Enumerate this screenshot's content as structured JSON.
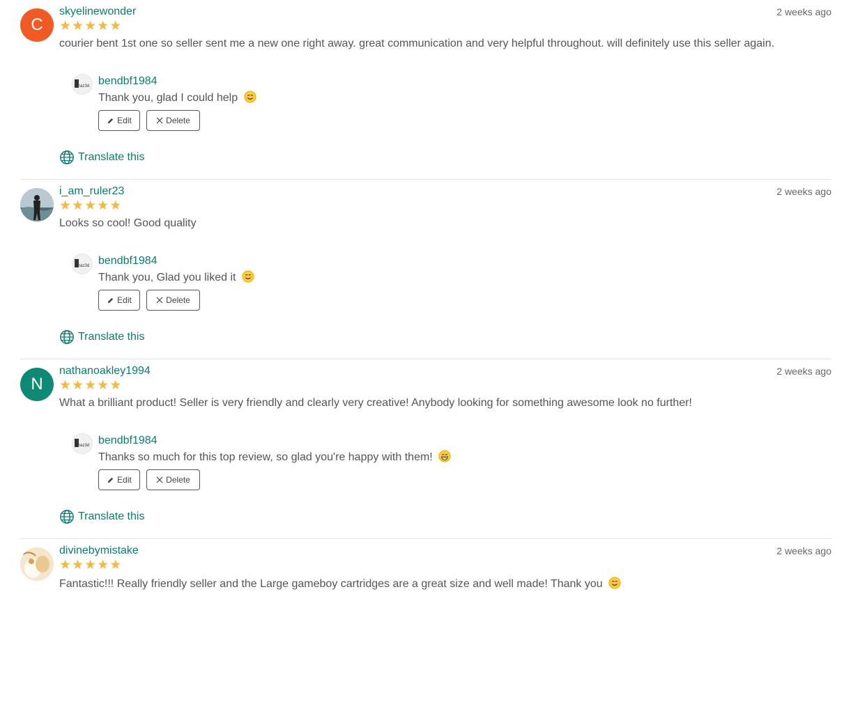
{
  "reviews": [
    {
      "username": "skyelinewonder",
      "avatar_letter": "C",
      "avatar_color": "#f05a24",
      "date": "2 weeks ago",
      "stars": 5,
      "text": "courier bent 1st one so seller sent me a new one right away. great communication and very helpful throughout. will definitely use this seller again.",
      "reply": {
        "username": "bendbf1984",
        "avatar_text": "Phaz3d",
        "text": "Thank you, glad I could help",
        "emoji": "smiling-face-icon"
      },
      "edit_label": "Edit",
      "delete_label": "Delete",
      "translate_label": "Translate this"
    },
    {
      "username": "i_am_ruler23",
      "avatar_letter": "",
      "avatar_color": "#8aa4b0",
      "date": "2 weeks ago",
      "stars": 5,
      "text": "Looks so cool! Good quality",
      "reply": {
        "username": "bendbf1984",
        "avatar_text": "Phaz3d",
        "text": "Thank you, Glad you liked it",
        "emoji": "smiling-face-icon"
      },
      "edit_label": "Edit",
      "delete_label": "Delete",
      "translate_label": "Translate this"
    },
    {
      "username": "nathanoakley1994",
      "avatar_letter": "N",
      "avatar_color": "#0e8a74",
      "date": "2 weeks ago",
      "stars": 5,
      "text": "What a brilliant product! Seller is very friendly and clearly very creative! Anybody looking for something awesome look no further!",
      "reply": {
        "username": "bendbf1984",
        "avatar_text": "Phaz3d",
        "text": "Thanks so much for this top review, so glad you're happy with them!",
        "emoji": "grinning-face-icon"
      },
      "edit_label": "Edit",
      "delete_label": "Delete",
      "translate_label": "Translate this"
    },
    {
      "username": "divinebymistake",
      "avatar_letter": "",
      "avatar_color": "#e9d7b5",
      "date": "2 weeks ago",
      "stars": 5,
      "text": "Fantastic!!! Really friendly seller and the Large gameboy cartridges are a great size and well made! Thank you",
      "emoji": "smiling-face-icon"
    }
  ],
  "colors": {
    "accent": "#0b7b70",
    "star": "#f4b940"
  }
}
